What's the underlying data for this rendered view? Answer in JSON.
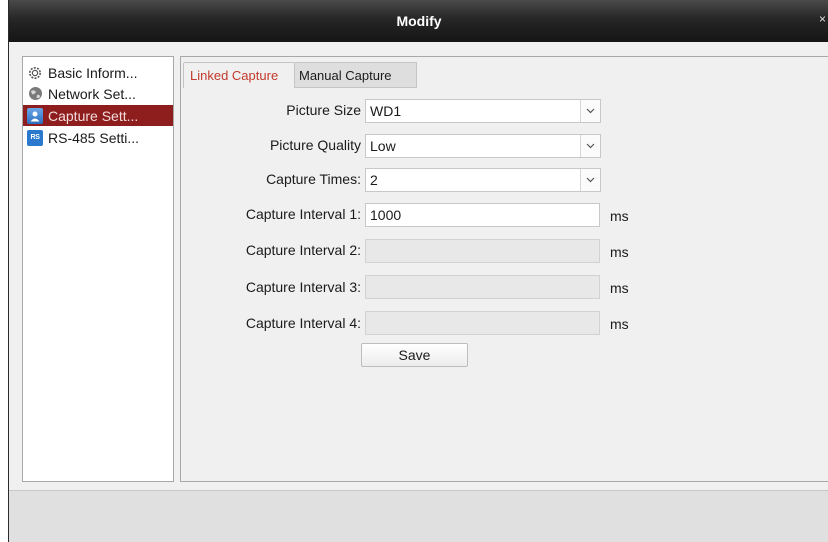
{
  "window": {
    "title": "Modify",
    "close_glyph": "×"
  },
  "sidebar": {
    "items": [
      {
        "label": "Basic Inform...",
        "icon": "gear-icon"
      },
      {
        "label": "Network Set...",
        "icon": "globe-icon"
      },
      {
        "label": "Capture Sett...",
        "icon": "user-capture-icon",
        "selected": true
      },
      {
        "label": "RS-485 Setti...",
        "icon": "rs485-icon",
        "icon_text": "RS"
      }
    ]
  },
  "tabs": [
    {
      "label": "Linked Capture",
      "active": true
    },
    {
      "label": "Manual Capture",
      "active": false
    }
  ],
  "form": {
    "picture_size": {
      "label": "Picture Size",
      "value": "WD1"
    },
    "picture_quality": {
      "label": "Picture Quality",
      "value": "Low"
    },
    "capture_times": {
      "label": "Capture Times:",
      "value": "2"
    },
    "intervals": [
      {
        "label": "Capture Interval 1:",
        "value": "1000",
        "unit": "ms",
        "enabled": true
      },
      {
        "label": "Capture Interval 2:",
        "value": "",
        "unit": "ms",
        "enabled": false
      },
      {
        "label": "Capture Interval 3:",
        "value": "",
        "unit": "ms",
        "enabled": false
      },
      {
        "label": "Capture Interval 4:",
        "value": "",
        "unit": "ms",
        "enabled": false
      }
    ],
    "save_label": "Save"
  },
  "colors": {
    "selected_item_bg": "#8e1e1e",
    "active_tab_text": "#c0392b",
    "titlebar_bg": "#1e1e1e"
  }
}
